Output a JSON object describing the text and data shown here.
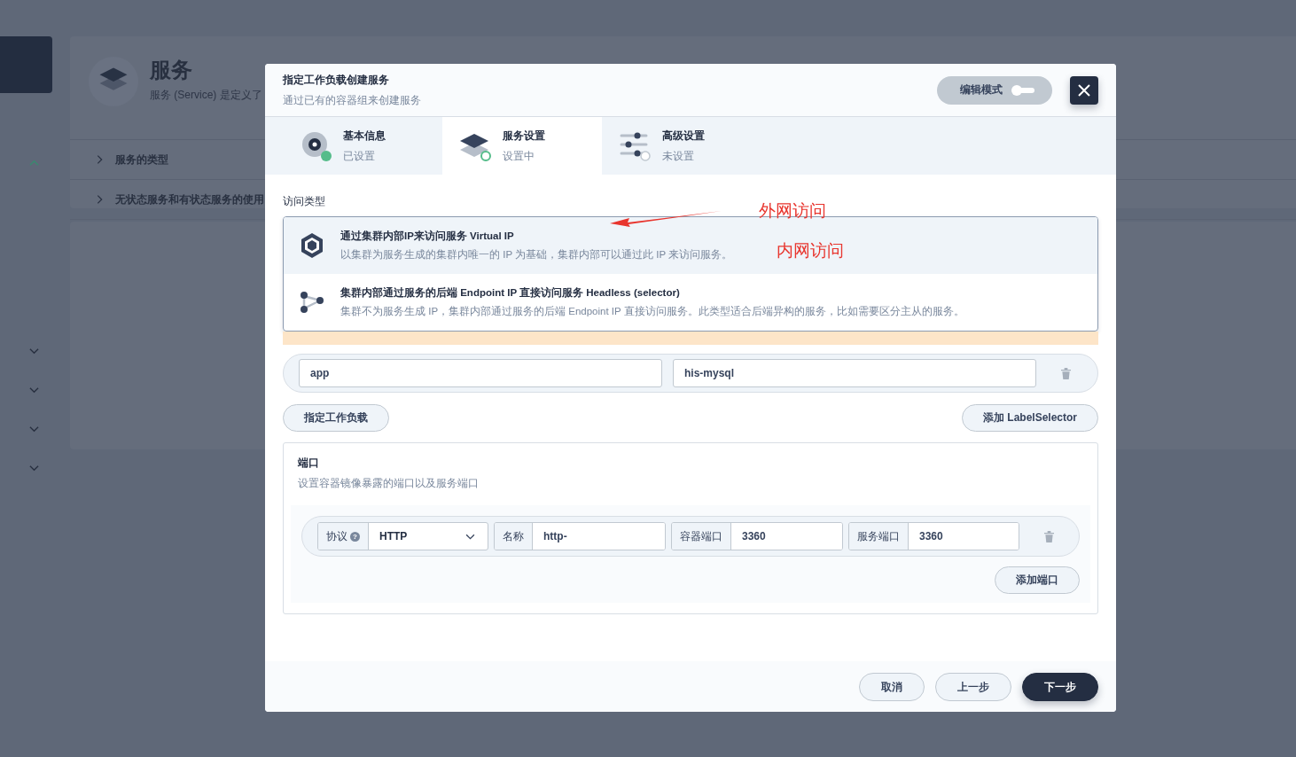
{
  "background": {
    "nav_chevrons": [
      {
        "expanded": true
      },
      {
        "expanded": false
      },
      {
        "expanded": false
      },
      {
        "expanded": false
      },
      {
        "expanded": false
      }
    ],
    "page_title": "服务",
    "page_description": "服务 (Service) 是定义了",
    "sections": [
      {
        "label": "服务的类型",
        "expanded": false
      },
      {
        "label": "无状态服务和有状态服务的使用",
        "expanded": false
      }
    ]
  },
  "modal": {
    "title": "指定工作负载创建服务",
    "subtitle": "通过已有的容器组来创建服务",
    "edit_mode": {
      "label": "编辑模式",
      "on": false
    },
    "steps": [
      {
        "title": "基本信息",
        "status": "已设置",
        "completed": true,
        "kind": "info",
        "selected": false
      },
      {
        "title": "服务设置",
        "status": "设置中",
        "completed": false,
        "kind": "layers",
        "selected": true
      },
      {
        "title": "高级设置",
        "status": "未设置",
        "completed": false,
        "kind": "sliders",
        "selected": false
      }
    ],
    "access_type_label": "访问类型",
    "access_options": [
      {
        "kind": "vip",
        "title": "通过集群内部IP来访问服务 Virtual IP",
        "description": "以集群为服务生成的集群内唯一的 IP 为基础，集群内部可以通过此 IP 来访问服务。",
        "selected": true
      },
      {
        "kind": "headless",
        "title": "集群内部通过服务的后端 Endpoint IP 直接访问服务 Headless (selector)",
        "description": "集群不为服务生成 IP，集群内部通过服务的后端 Endpoint IP 直接访问服务。此类型适合后端异构的服务，比如需要区分主从的服务。",
        "selected": false
      }
    ],
    "label_selector": {
      "key": "app",
      "value": "his-mysql"
    },
    "assign_workload_button": "指定工作负载",
    "add_label_selector_button": "添加 LabelSelector",
    "ports": {
      "title": "端口",
      "description": "设置容器镜像暴露的端口以及服务端口",
      "rows": [
        {
          "protocol_label": "协议",
          "help": "?",
          "protocol": "HTTP",
          "name_label": "名称",
          "name": "http-",
          "container_port_label": "容器端口",
          "container_port": "3360",
          "service_port_label": "服务端口",
          "service_port": "3360"
        }
      ],
      "add_button": "添加端口"
    },
    "footer_buttons": [
      {
        "label": "取消",
        "kind": "secondary"
      },
      {
        "label": "上一步",
        "kind": "secondary"
      },
      {
        "label": "下一步",
        "kind": "primary"
      }
    ]
  },
  "annotations": [
    {
      "text": "外网访问"
    },
    {
      "text": "内网访问"
    }
  ]
}
